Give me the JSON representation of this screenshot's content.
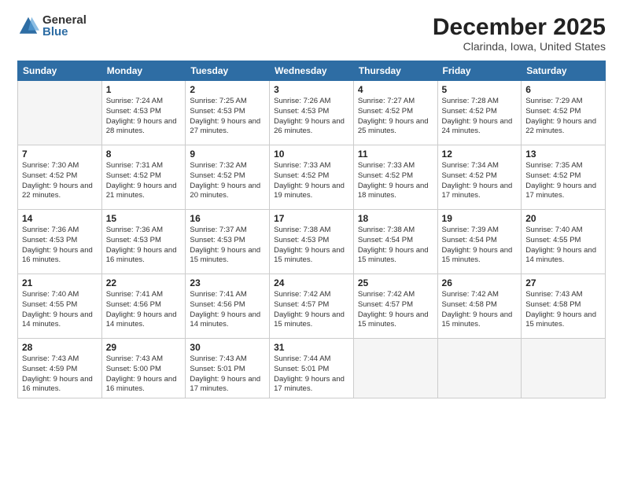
{
  "logo": {
    "general": "General",
    "blue": "Blue"
  },
  "title": "December 2025",
  "location": "Clarinda, Iowa, United States",
  "days_of_week": [
    "Sunday",
    "Monday",
    "Tuesday",
    "Wednesday",
    "Thursday",
    "Friday",
    "Saturday"
  ],
  "weeks": [
    [
      {
        "num": "",
        "empty": true
      },
      {
        "num": "1",
        "sunrise": "7:24 AM",
        "sunset": "4:53 PM",
        "daylight": "9 hours and 28 minutes."
      },
      {
        "num": "2",
        "sunrise": "7:25 AM",
        "sunset": "4:53 PM",
        "daylight": "9 hours and 27 minutes."
      },
      {
        "num": "3",
        "sunrise": "7:26 AM",
        "sunset": "4:53 PM",
        "daylight": "9 hours and 26 minutes."
      },
      {
        "num": "4",
        "sunrise": "7:27 AM",
        "sunset": "4:52 PM",
        "daylight": "9 hours and 25 minutes."
      },
      {
        "num": "5",
        "sunrise": "7:28 AM",
        "sunset": "4:52 PM",
        "daylight": "9 hours and 24 minutes."
      },
      {
        "num": "6",
        "sunrise": "7:29 AM",
        "sunset": "4:52 PM",
        "daylight": "9 hours and 22 minutes."
      }
    ],
    [
      {
        "num": "7",
        "sunrise": "7:30 AM",
        "sunset": "4:52 PM",
        "daylight": "9 hours and 22 minutes."
      },
      {
        "num": "8",
        "sunrise": "7:31 AM",
        "sunset": "4:52 PM",
        "daylight": "9 hours and 21 minutes."
      },
      {
        "num": "9",
        "sunrise": "7:32 AM",
        "sunset": "4:52 PM",
        "daylight": "9 hours and 20 minutes."
      },
      {
        "num": "10",
        "sunrise": "7:33 AM",
        "sunset": "4:52 PM",
        "daylight": "9 hours and 19 minutes."
      },
      {
        "num": "11",
        "sunrise": "7:33 AM",
        "sunset": "4:52 PM",
        "daylight": "9 hours and 18 minutes."
      },
      {
        "num": "12",
        "sunrise": "7:34 AM",
        "sunset": "4:52 PM",
        "daylight": "9 hours and 17 minutes."
      },
      {
        "num": "13",
        "sunrise": "7:35 AM",
        "sunset": "4:52 PM",
        "daylight": "9 hours and 17 minutes."
      }
    ],
    [
      {
        "num": "14",
        "sunrise": "7:36 AM",
        "sunset": "4:53 PM",
        "daylight": "9 hours and 16 minutes."
      },
      {
        "num": "15",
        "sunrise": "7:36 AM",
        "sunset": "4:53 PM",
        "daylight": "9 hours and 16 minutes."
      },
      {
        "num": "16",
        "sunrise": "7:37 AM",
        "sunset": "4:53 PM",
        "daylight": "9 hours and 15 minutes."
      },
      {
        "num": "17",
        "sunrise": "7:38 AM",
        "sunset": "4:53 PM",
        "daylight": "9 hours and 15 minutes."
      },
      {
        "num": "18",
        "sunrise": "7:38 AM",
        "sunset": "4:54 PM",
        "daylight": "9 hours and 15 minutes."
      },
      {
        "num": "19",
        "sunrise": "7:39 AM",
        "sunset": "4:54 PM",
        "daylight": "9 hours and 15 minutes."
      },
      {
        "num": "20",
        "sunrise": "7:40 AM",
        "sunset": "4:55 PM",
        "daylight": "9 hours and 14 minutes."
      }
    ],
    [
      {
        "num": "21",
        "sunrise": "7:40 AM",
        "sunset": "4:55 PM",
        "daylight": "9 hours and 14 minutes."
      },
      {
        "num": "22",
        "sunrise": "7:41 AM",
        "sunset": "4:56 PM",
        "daylight": "9 hours and 14 minutes."
      },
      {
        "num": "23",
        "sunrise": "7:41 AM",
        "sunset": "4:56 PM",
        "daylight": "9 hours and 14 minutes."
      },
      {
        "num": "24",
        "sunrise": "7:42 AM",
        "sunset": "4:57 PM",
        "daylight": "9 hours and 15 minutes."
      },
      {
        "num": "25",
        "sunrise": "7:42 AM",
        "sunset": "4:57 PM",
        "daylight": "9 hours and 15 minutes."
      },
      {
        "num": "26",
        "sunrise": "7:42 AM",
        "sunset": "4:58 PM",
        "daylight": "9 hours and 15 minutes."
      },
      {
        "num": "27",
        "sunrise": "7:43 AM",
        "sunset": "4:58 PM",
        "daylight": "9 hours and 15 minutes."
      }
    ],
    [
      {
        "num": "28",
        "sunrise": "7:43 AM",
        "sunset": "4:59 PM",
        "daylight": "9 hours and 16 minutes."
      },
      {
        "num": "29",
        "sunrise": "7:43 AM",
        "sunset": "5:00 PM",
        "daylight": "9 hours and 16 minutes."
      },
      {
        "num": "30",
        "sunrise": "7:43 AM",
        "sunset": "5:01 PM",
        "daylight": "9 hours and 17 minutes."
      },
      {
        "num": "31",
        "sunrise": "7:44 AM",
        "sunset": "5:01 PM",
        "daylight": "9 hours and 17 minutes."
      },
      {
        "num": "",
        "empty": true
      },
      {
        "num": "",
        "empty": true
      },
      {
        "num": "",
        "empty": true
      }
    ]
  ]
}
